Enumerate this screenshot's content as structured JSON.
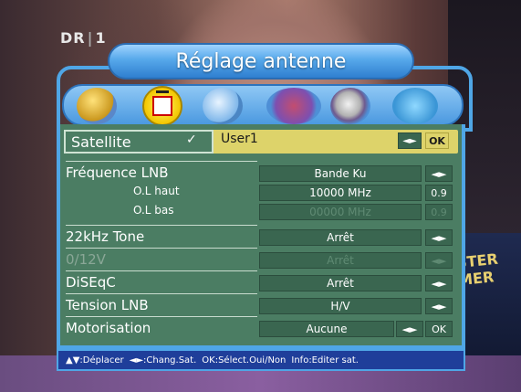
{
  "channel": {
    "logo": "DR",
    "number": "1"
  },
  "dialog": {
    "title": "Réglage antenne"
  },
  "icons": [
    "satellite-dish-icon",
    "antenna-tv-icon",
    "search-icon",
    "tools-icon",
    "stopwatch-icon",
    "back-arrow-icon"
  ],
  "satellite": {
    "label": "Satellite",
    "check": "✓",
    "value": "User1",
    "arrows": "◄►",
    "ok": "OK"
  },
  "lnb": {
    "label": "Fréquence LNB",
    "value": "Bande Ku",
    "arrows": "◄►",
    "ol_haut_label": "O.L haut",
    "ol_haut_value": "10000 MHz",
    "ol_haut_btn": "0.9",
    "ol_bas_label": "O.L bas",
    "ol_bas_value": "00000 MHz",
    "ol_bas_btn": "0.9"
  },
  "tone": {
    "label": "22kHz Tone",
    "value": "Arrêt",
    "arrows": "◄►"
  },
  "v012": {
    "label": "0/12V",
    "value": "Arrêt",
    "arrows": "◄►"
  },
  "diseqc": {
    "label": "DiSEqC",
    "value": "Arrêt",
    "arrows": "◄►"
  },
  "tension": {
    "label": "Tension LNB",
    "value": "H/V",
    "arrows": "◄►"
  },
  "motor": {
    "label": "Motorisation",
    "value": "Aucune",
    "arrows": "◄►",
    "ok": "OK"
  },
  "help": {
    "move": "▲▼:Déplacer",
    "change": "◄►:Chang.Sat.",
    "ok": "OK:Sélect.Oui/Non",
    "info": "Info:Editer sat."
  },
  "background_poster": "STER MER",
  "colors": {
    "panel": "#4b7d63",
    "frame": "#4fa6e6",
    "highlight": "#ddd36a",
    "help_bar": "#1f3e9a"
  }
}
